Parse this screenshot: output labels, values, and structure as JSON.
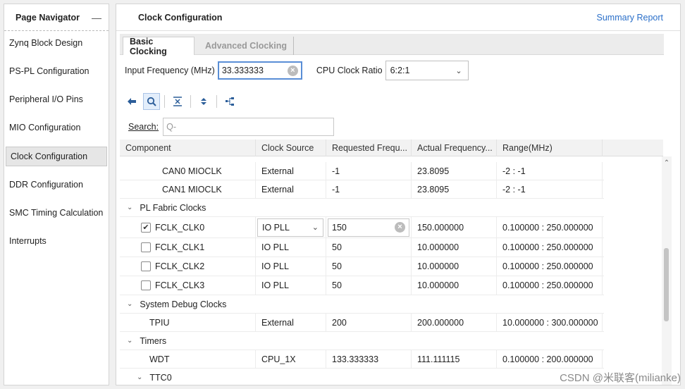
{
  "navigator": {
    "title": "Page Navigator",
    "minimize": "—",
    "items": [
      {
        "label": "Zynq Block Design"
      },
      {
        "label": "PS-PL Configuration"
      },
      {
        "label": "Peripheral I/O Pins"
      },
      {
        "label": "MIO Configuration"
      },
      {
        "label": "Clock Configuration",
        "active": true
      },
      {
        "label": "DDR Configuration"
      },
      {
        "label": "SMC Timing Calculation"
      },
      {
        "label": "Interrupts"
      }
    ]
  },
  "main": {
    "title": "Clock Configuration",
    "summary_link": "Summary Report",
    "tabs": [
      {
        "label": "Basic Clocking",
        "active": true
      },
      {
        "label": "Advanced Clocking",
        "active": false
      }
    ],
    "input_freq_label": "Input Frequency (MHz)",
    "input_freq_value": "33.333333",
    "cpu_ratio_label": "CPU Clock Ratio",
    "cpu_ratio_value": "6:2:1",
    "search_label": "Search:",
    "search_placeholder": "Q-"
  },
  "toolbar": {
    "icons": [
      "back-arrow-icon",
      "search-icon",
      "collapse-all-icon",
      "expand-all-icon",
      "hierarchy-icon"
    ]
  },
  "table": {
    "headers": [
      "Component",
      "Clock Source",
      "Requested Frequ...",
      "Actual Frequency...",
      "Range(MHz)"
    ],
    "rows": {
      "can0": {
        "component": "CAN0 MIOCLK",
        "source": "External",
        "requested": "-1",
        "actual": "23.8095",
        "range": "-2 : -1"
      },
      "can1": {
        "component": "CAN1 MIOCLK",
        "source": "External",
        "requested": "-1",
        "actual": "23.8095",
        "range": "-2 : -1"
      },
      "pl_group": "PL Fabric Clocks",
      "fclk0": {
        "component": "FCLK_CLK0",
        "checked": true,
        "source": "IO PLL",
        "requested": "150",
        "actual": "150.000000",
        "range": "0.100000 : 250.000000"
      },
      "fclk1": {
        "component": "FCLK_CLK1",
        "checked": false,
        "source": "IO PLL",
        "requested": "50",
        "actual": "10.000000",
        "range": "0.100000 : 250.000000"
      },
      "fclk2": {
        "component": "FCLK_CLK2",
        "checked": false,
        "source": "IO PLL",
        "requested": "50",
        "actual": "10.000000",
        "range": "0.100000 : 250.000000"
      },
      "fclk3": {
        "component": "FCLK_CLK3",
        "checked": false,
        "source": "IO PLL",
        "requested": "50",
        "actual": "10.000000",
        "range": "0.100000 : 250.000000"
      },
      "debug_group": "System Debug Clocks",
      "tpiu": {
        "component": "TPIU",
        "source": "External",
        "requested": "200",
        "actual": "200.000000",
        "range": "10.000000 : 300.000000"
      },
      "timers_group": "Timers",
      "wdt": {
        "component": "WDT",
        "source": "CPU_1X",
        "requested": "133.333333",
        "actual": "111.111115",
        "range": "0.100000 : 200.000000"
      },
      "ttc0_group": "TTC0"
    }
  },
  "watermark": "CSDN @米联客(milianke)",
  "colors": {
    "accent": "#2a6fc9",
    "focus_border": "#5a8ed6"
  }
}
